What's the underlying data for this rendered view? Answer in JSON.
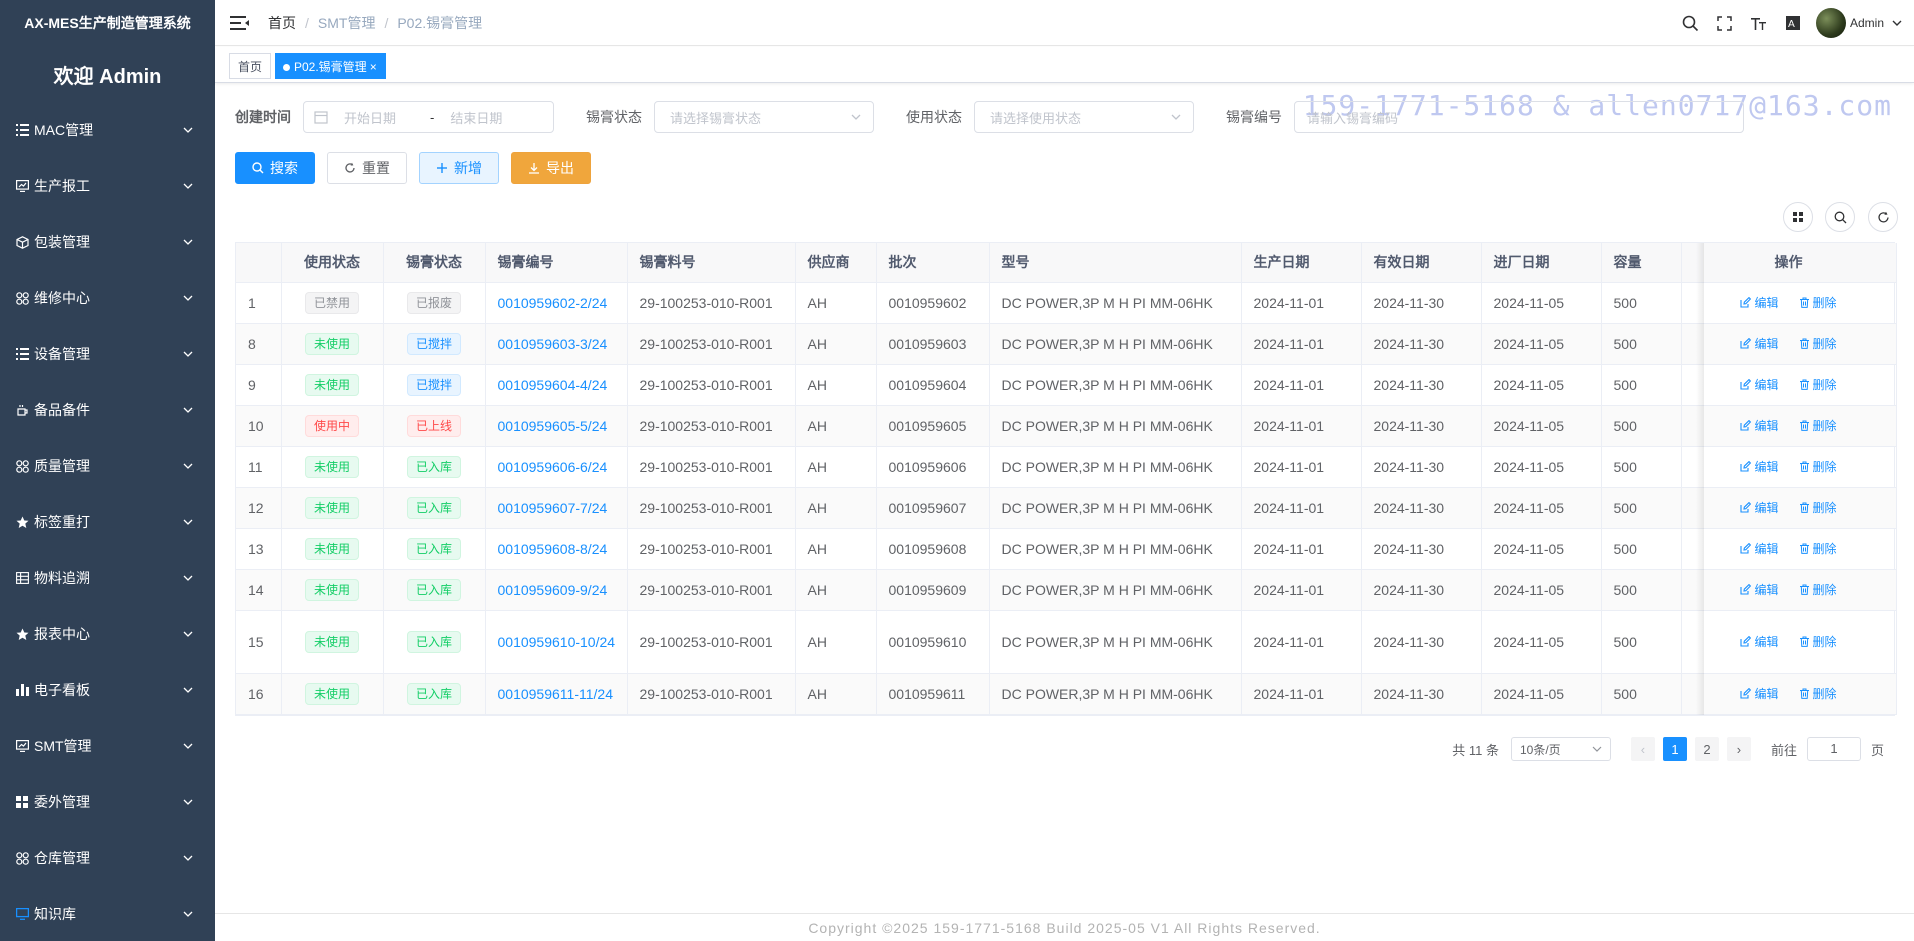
{
  "app": {
    "title": "AX-MES生产制造管理系统",
    "welcome": "欢迎 Admin"
  },
  "sidebar": {
    "items": [
      {
        "label": "MAC管理",
        "icon": "list-icon"
      },
      {
        "label": "生产报工",
        "icon": "monitor-chart-icon"
      },
      {
        "label": "包装管理",
        "icon": "box-icon"
      },
      {
        "label": "维修中心",
        "icon": "component-icon"
      },
      {
        "label": "设备管理",
        "icon": "list-icon"
      },
      {
        "label": "备品备件",
        "icon": "cup-icon"
      },
      {
        "label": "质量管理",
        "icon": "component-icon"
      },
      {
        "label": "标签重打",
        "icon": "star-icon"
      },
      {
        "label": "物料追溯",
        "icon": "table-icon"
      },
      {
        "label": "报表中心",
        "icon": "star-icon"
      },
      {
        "label": "电子看板",
        "icon": "bar-chart-icon"
      },
      {
        "label": "SMT管理",
        "icon": "monitor-chart-icon"
      },
      {
        "label": "委外管理",
        "icon": "grid-icon"
      },
      {
        "label": "仓库管理",
        "icon": "component-icon"
      },
      {
        "label": "知识库",
        "icon": "monitor-icon"
      }
    ]
  },
  "header": {
    "breadcrumb": [
      "首页",
      "SMT管理",
      "P02.锡膏管理"
    ],
    "user": "Admin"
  },
  "tags": {
    "home": "首页",
    "active": "P02.锡膏管理",
    "close": "×"
  },
  "watermark": "159-1771-5168 & allen0717@163.com",
  "search": {
    "created_label": "创建时间",
    "start_placeholder": "开始日期",
    "range_sep": "-",
    "end_placeholder": "结束日期",
    "paste_status_label": "锡膏状态",
    "paste_status_placeholder": "请选择锡膏状态",
    "use_status_label": "使用状态",
    "use_status_placeholder": "请选择使用状态",
    "code_label": "锡膏编号",
    "code_placeholder": "请输入锡膏编码"
  },
  "buttons": {
    "search": "搜索",
    "reset": "重置",
    "add": "新增",
    "export": "导出"
  },
  "table": {
    "headers": [
      "",
      "使用状态",
      "锡膏状态",
      "锡膏编号",
      "锡膏料号",
      "供应商",
      "批次",
      "型号",
      "生产日期",
      "有效日期",
      "进厂日期",
      "容量",
      "操作"
    ],
    "edit_label": "编辑",
    "delete_label": "删除",
    "rows": [
      {
        "id": "1",
        "use": "已禁用",
        "use_type": "info",
        "status": "已报废",
        "status_type": "info",
        "code": "0010959602-2/24",
        "pn": "29-100253-010-R001",
        "vendor": "AH",
        "batch": "0010959602",
        "model": "DC POWER,3P M H PI MM-06HK",
        "mfg": "2024-11-01",
        "exp": "2024-11-30",
        "in": "2024-11-05",
        "cap": "500"
      },
      {
        "id": "8",
        "use": "未使用",
        "use_type": "success",
        "status": "已搅拌",
        "status_type": "primary",
        "code": "0010959603-3/24",
        "pn": "29-100253-010-R001",
        "vendor": "AH",
        "batch": "0010959603",
        "model": "DC POWER,3P M H PI MM-06HK",
        "mfg": "2024-11-01",
        "exp": "2024-11-30",
        "in": "2024-11-05",
        "cap": "500"
      },
      {
        "id": "9",
        "use": "未使用",
        "use_type": "success",
        "status": "已搅拌",
        "status_type": "primary",
        "code": "0010959604-4/24",
        "pn": "29-100253-010-R001",
        "vendor": "AH",
        "batch": "0010959604",
        "model": "DC POWER,3P M H PI MM-06HK",
        "mfg": "2024-11-01",
        "exp": "2024-11-30",
        "in": "2024-11-05",
        "cap": "500"
      },
      {
        "id": "10",
        "use": "使用中",
        "use_type": "danger",
        "status": "已上线",
        "status_type": "danger",
        "code": "0010959605-5/24",
        "pn": "29-100253-010-R001",
        "vendor": "AH",
        "batch": "0010959605",
        "model": "DC POWER,3P M H PI MM-06HK",
        "mfg": "2024-11-01",
        "exp": "2024-11-30",
        "in": "2024-11-05",
        "cap": "500"
      },
      {
        "id": "11",
        "use": "未使用",
        "use_type": "success",
        "status": "已入库",
        "status_type": "success",
        "code": "0010959606-6/24",
        "pn": "29-100253-010-R001",
        "vendor": "AH",
        "batch": "0010959606",
        "model": "DC POWER,3P M H PI MM-06HK",
        "mfg": "2024-11-01",
        "exp": "2024-11-30",
        "in": "2024-11-05",
        "cap": "500"
      },
      {
        "id": "12",
        "use": "未使用",
        "use_type": "success",
        "status": "已入库",
        "status_type": "success",
        "code": "0010959607-7/24",
        "pn": "29-100253-010-R001",
        "vendor": "AH",
        "batch": "0010959607",
        "model": "DC POWER,3P M H PI MM-06HK",
        "mfg": "2024-11-01",
        "exp": "2024-11-30",
        "in": "2024-11-05",
        "cap": "500"
      },
      {
        "id": "13",
        "use": "未使用",
        "use_type": "success",
        "status": "已入库",
        "status_type": "success",
        "code": "0010959608-8/24",
        "pn": "29-100253-010-R001",
        "vendor": "AH",
        "batch": "0010959608",
        "model": "DC POWER,3P M H PI MM-06HK",
        "mfg": "2024-11-01",
        "exp": "2024-11-30",
        "in": "2024-11-05",
        "cap": "500"
      },
      {
        "id": "14",
        "use": "未使用",
        "use_type": "success",
        "status": "已入库",
        "status_type": "success",
        "code": "0010959609-9/24",
        "pn": "29-100253-010-R001",
        "vendor": "AH",
        "batch": "0010959609",
        "model": "DC POWER,3P M H PI MM-06HK",
        "mfg": "2024-11-01",
        "exp": "2024-11-30",
        "in": "2024-11-05",
        "cap": "500"
      },
      {
        "id": "15",
        "use": "未使用",
        "use_type": "success",
        "status": "已入库",
        "status_type": "success",
        "code": "0010959610-10/24",
        "pn": "29-100253-010-R001",
        "vendor": "AH",
        "batch": "0010959610",
        "model": "DC POWER,3P M H PI MM-06HK",
        "mfg": "2024-11-01",
        "exp": "2024-11-30",
        "in": "2024-11-05",
        "cap": "500"
      },
      {
        "id": "16",
        "use": "未使用",
        "use_type": "success",
        "status": "已入库",
        "status_type": "success",
        "code": "0010959611-11/24",
        "pn": "29-100253-010-R001",
        "vendor": "AH",
        "batch": "0010959611",
        "model": "DC POWER,3P M H PI MM-06HK",
        "mfg": "2024-11-01",
        "exp": "2024-11-30",
        "in": "2024-11-05",
        "cap": "500"
      }
    ]
  },
  "pagination": {
    "total": "共 11 条",
    "page_size": "10条/页",
    "pages": [
      "1",
      "2"
    ],
    "current": "1",
    "goto_prefix": "前往",
    "goto_value": "1",
    "goto_suffix": "页"
  },
  "footer": "Copyright ©2025 159-1771-5168 Build 2025-05 V1 All Rights Reserved.",
  "colors": {
    "sidebar_bg": "#304156",
    "primary": "#1890ff",
    "warning": "#f0a63c",
    "success": "#13ce66",
    "danger": "#ff4949"
  }
}
